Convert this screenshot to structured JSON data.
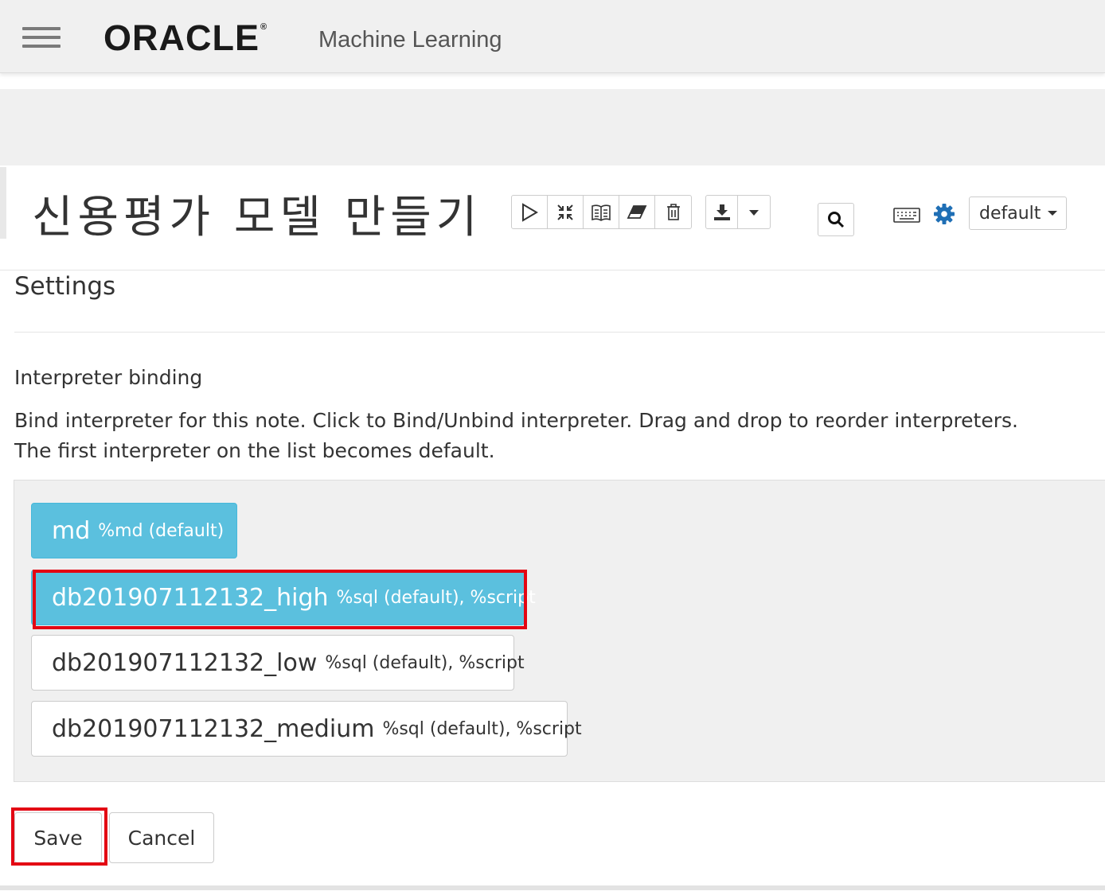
{
  "header": {
    "logo_text": "ORACLE",
    "logo_mark": "®",
    "product_name": "Machine Learning",
    "menu_icon": "hamburger-menu-icon"
  },
  "note": {
    "title": "신용평가 모델 만들기",
    "toolbar": {
      "icons": [
        "run-all-icon",
        "toggle-code-icon",
        "toggle-output-icon",
        "clear-output-icon",
        "delete-icon",
        "export-icon",
        "caret-down-icon",
        "search-icon",
        "keyboard-icon",
        "gear-icon"
      ],
      "dropdown_value": "default"
    }
  },
  "settings": {
    "title": "Settings",
    "section_title": "Interpreter binding",
    "description_line1": "Bind interpreter for this note. Click to Bind/Unbind interpreter. Drag and drop to reorder interpreters.",
    "description_line2": "The first interpreter on the list becomes default.",
    "interpreters": [
      {
        "name": "md",
        "aliases": "%md (default)",
        "bound": true
      },
      {
        "name": "db201907112132_high",
        "aliases": "%sql (default), %script",
        "bound": true
      },
      {
        "name": "db201907112132_low",
        "aliases": "%sql (default), %script",
        "bound": false
      },
      {
        "name": "db201907112132_medium",
        "aliases": "%sql (default), %script",
        "bound": false
      }
    ],
    "save_label": "Save",
    "cancel_label": "Cancel"
  },
  "colors": {
    "bound_bg": "#5bc0de",
    "highlight": "#e30613",
    "header_bg": "#f0f0f0"
  }
}
